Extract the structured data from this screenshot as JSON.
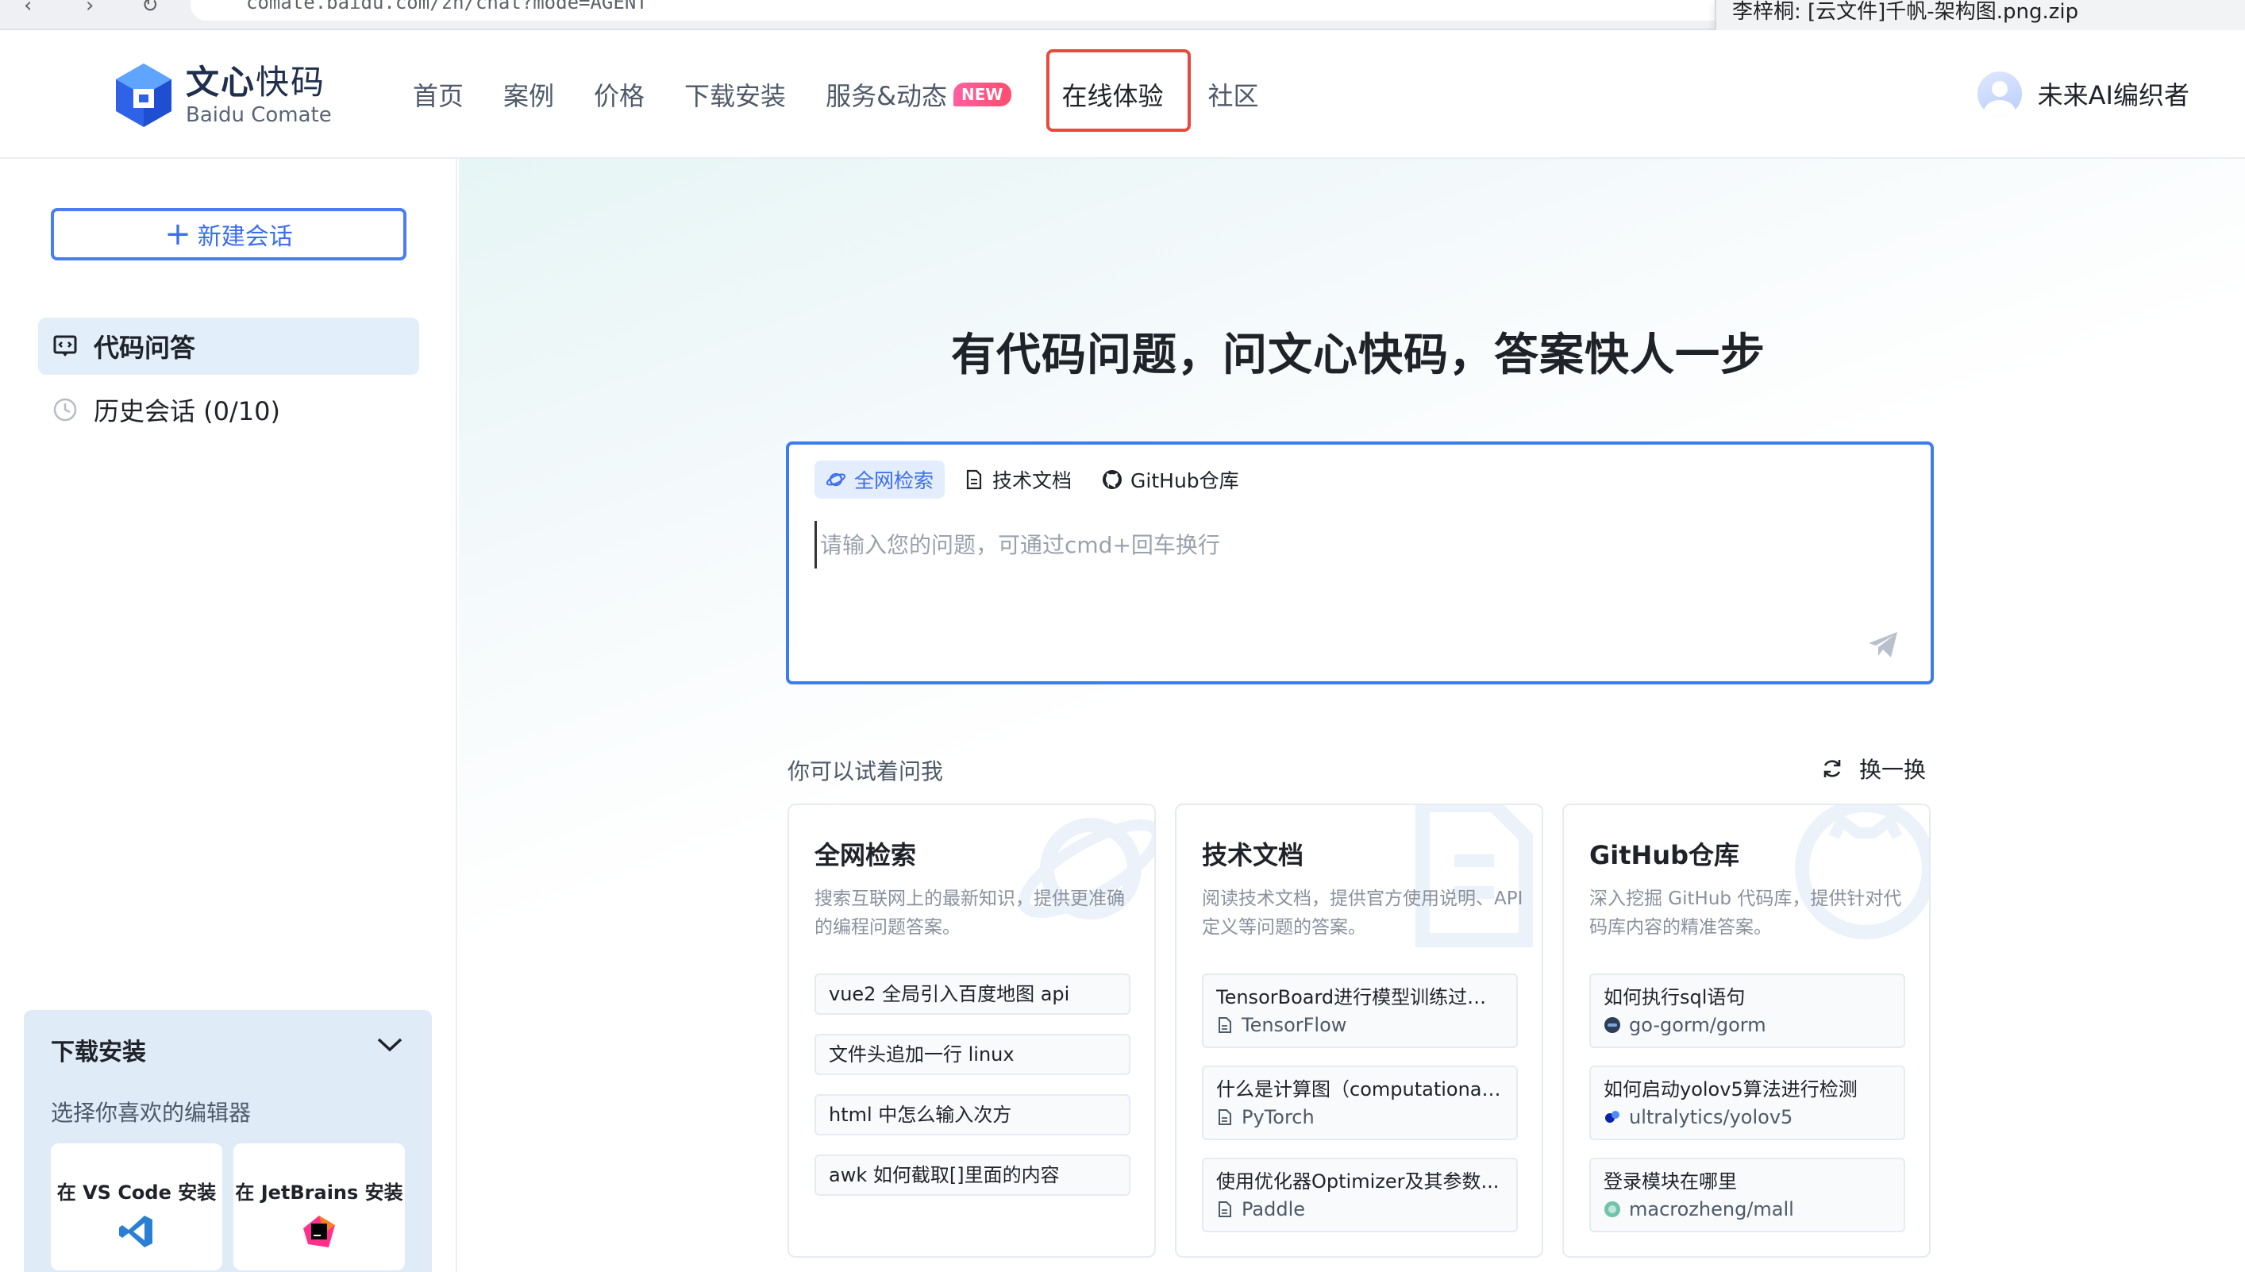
{
  "browser": {
    "url_text": "comate.baidu.com/zh/chat?mode=AGENT",
    "tooltip": "李梓桐: [云文件]千帆-架构图.png.zip"
  },
  "header": {
    "logo_cn_bold": "文心",
    "logo_cn_light": "快码",
    "logo_en": "Baidu Comate",
    "nav": {
      "home": "首页",
      "cases": "案例",
      "price": "价格",
      "download": "下载安装",
      "service": "服务&动态",
      "new_badge": "NEW",
      "online": "在线体验",
      "community": "社区"
    },
    "user_name": "未来AI编织者"
  },
  "sidebar": {
    "new_chat": "新建会话",
    "qa": "代码问答",
    "history": "历史会话 (0/10)",
    "download": {
      "title": "下载安装",
      "subtitle": "选择你喜欢的编辑器",
      "vscode": "在 VS Code 安装",
      "jetbrains": "在 JetBrains 安装"
    }
  },
  "main": {
    "headline": "有代码问题，问文心快码，答案快人一步",
    "tabs": {
      "web": "全网检索",
      "docs": "技术文档",
      "github": "GitHub仓库"
    },
    "input_placeholder": "请输入您的问题，可通过cmd+回车换行",
    "try_title": "你可以试着问我",
    "refresh": "换一换",
    "cards": {
      "web": {
        "title": "全网检索",
        "desc": "搜索互联网上的最新知识，提供更准确的编程问题答案。",
        "questions": [
          "vue2 全局引入百度地图 api",
          "文件头追加一行 linux",
          "html 中怎么输入次方",
          "awk 如何截取[]里面的内容"
        ]
      },
      "docs": {
        "title": "技术文档",
        "desc": "阅读技术文档，提供官方使用说明、API定义等问题的答案。",
        "questions": [
          {
            "text": "TensorBoard进行模型训练过程...",
            "source": "TensorFlow"
          },
          {
            "text": "什么是计算图（computational ...",
            "source": "PyTorch"
          },
          {
            "text": "使用优化器Optimizer及其参数...",
            "source": "Paddle"
          }
        ]
      },
      "github": {
        "title": "GitHub仓库",
        "desc": "深入挖掘 GitHub 代码库，提供针对代码库内容的精准答案。",
        "questions": [
          {
            "text": "如何执行sql语句",
            "source": "go-gorm/gorm"
          },
          {
            "text": "如何启动yolov5算法进行检测",
            "source": "ultralytics/yolov5"
          },
          {
            "text": "登录模块在哪里",
            "source": "macrozheng/mall"
          }
        ]
      }
    }
  },
  "colors": {
    "accent": "#3b6ef0",
    "highlight_box": "#e84a3c",
    "active_bg": "#e3eefb",
    "badge": "#ff4d6d"
  }
}
